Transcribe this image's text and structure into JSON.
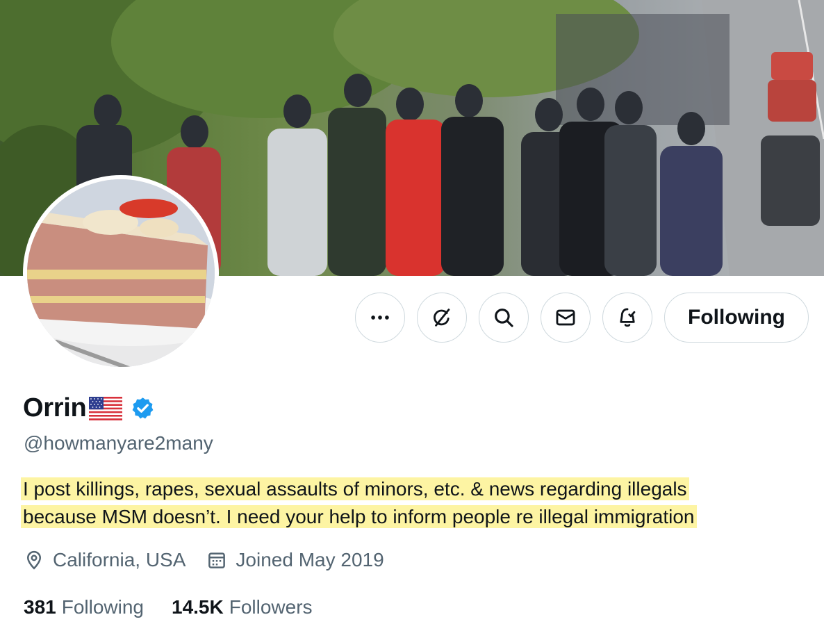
{
  "profile": {
    "name": "Orrin",
    "handle": "@howmanyare2many",
    "bio_line1": "I post killings, rapes, sexual assaults of minors, etc. & news regarding illegals",
    "bio_line2": "because MSM doesn’t. I need your help to inform people re illegal immigration",
    "location": "California, USA",
    "joined": "Joined May 2019",
    "following_count": "381",
    "following_label": "Following",
    "followers_count": "14.5K",
    "followers_label": "Followers"
  },
  "actions": {
    "follow_state_label": "Following",
    "icons": [
      "more-icon",
      "grok-icon",
      "search-icon",
      "mail-icon",
      "notification-bell-icon"
    ]
  },
  "colors": {
    "accent_verified": "#1d9bf0",
    "muted_text": "#536471",
    "highlight": "#fdf4a3",
    "border": "#cfd9de"
  }
}
